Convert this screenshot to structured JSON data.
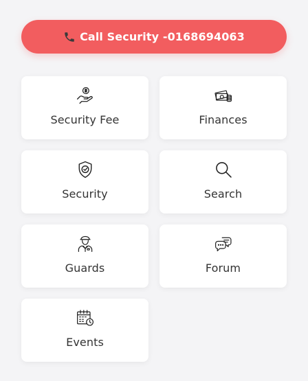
{
  "call_button": {
    "label": "Call Security -0168694063",
    "icon": "phone-icon",
    "color": "#f25d5f"
  },
  "tiles": [
    {
      "label": "Security Fee",
      "icon": "hand-coin-icon"
    },
    {
      "label": "Finances",
      "icon": "cash-coins-icon"
    },
    {
      "label": "Security",
      "icon": "shield-check-icon"
    },
    {
      "label": "Search",
      "icon": "search-icon"
    },
    {
      "label": "Guards",
      "icon": "guard-icon"
    },
    {
      "label": "Forum",
      "icon": "chat-bubbles-icon"
    },
    {
      "label": "Events",
      "icon": "calendar-clock-icon"
    }
  ]
}
